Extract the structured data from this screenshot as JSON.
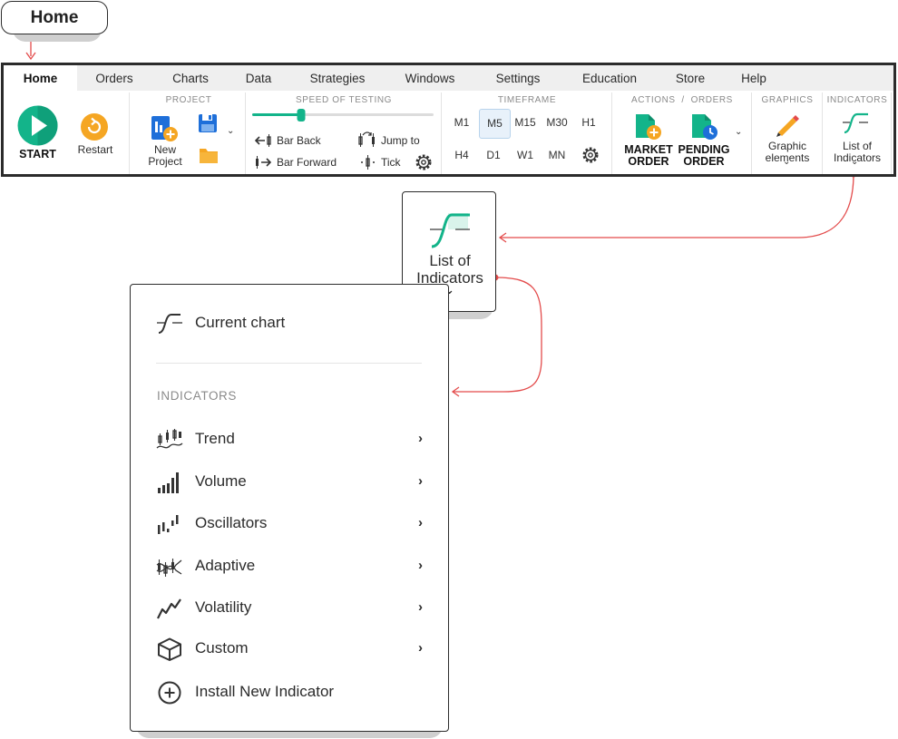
{
  "callout": {
    "home": "Home"
  },
  "tabs": [
    "Home",
    "Orders",
    "Charts",
    "Data",
    "Strategies",
    "Windows",
    "Settings",
    "Education",
    "Store",
    "Help"
  ],
  "groups": {
    "project": "PROJECT",
    "speed": "SPEED OF TESTING",
    "timeframe": "TIMEFRAME",
    "actions": "ACTIONS  /  ORDERS",
    "graphics": "GRAPHICS",
    "indicators": "INDICATORS"
  },
  "buttons": {
    "start": "START",
    "restart": "Restart",
    "new_project_l1": "New",
    "new_project_l2": "Project",
    "bar_back": "Bar Back",
    "bar_forward": "Bar Forward",
    "jump_to": "Jump to",
    "tick": "Tick",
    "market_l1": "MARKET",
    "market_l2": "ORDER",
    "pending_l1": "PENDING",
    "pending_l2": "ORDER",
    "graphic_l1": "Graphic",
    "graphic_l2": "elements",
    "indicators_l1": "List of",
    "indicators_l2": "Indicators"
  },
  "speed_slider": {
    "value": 0.27
  },
  "timeframes": {
    "row1": [
      "M1",
      "M5",
      "M15",
      "M30",
      "H1"
    ],
    "row2": [
      "H4",
      "D1",
      "W1",
      "MN"
    ],
    "selected": "M5"
  },
  "popup": {
    "line1": "List of",
    "line2": "Indicators"
  },
  "menu": {
    "current_chart": "Current chart",
    "section": "INDICATORS",
    "items": [
      "Trend",
      "Volume",
      "Oscillators",
      "Adaptive",
      "Volatility",
      "Custom"
    ],
    "install": "Install New Indicator"
  },
  "colors": {
    "accent_green": "#13b48a",
    "accent_orange": "#f5a623",
    "annotation_red": "#e34b4b",
    "accent_blue": "#1e6fd9"
  }
}
